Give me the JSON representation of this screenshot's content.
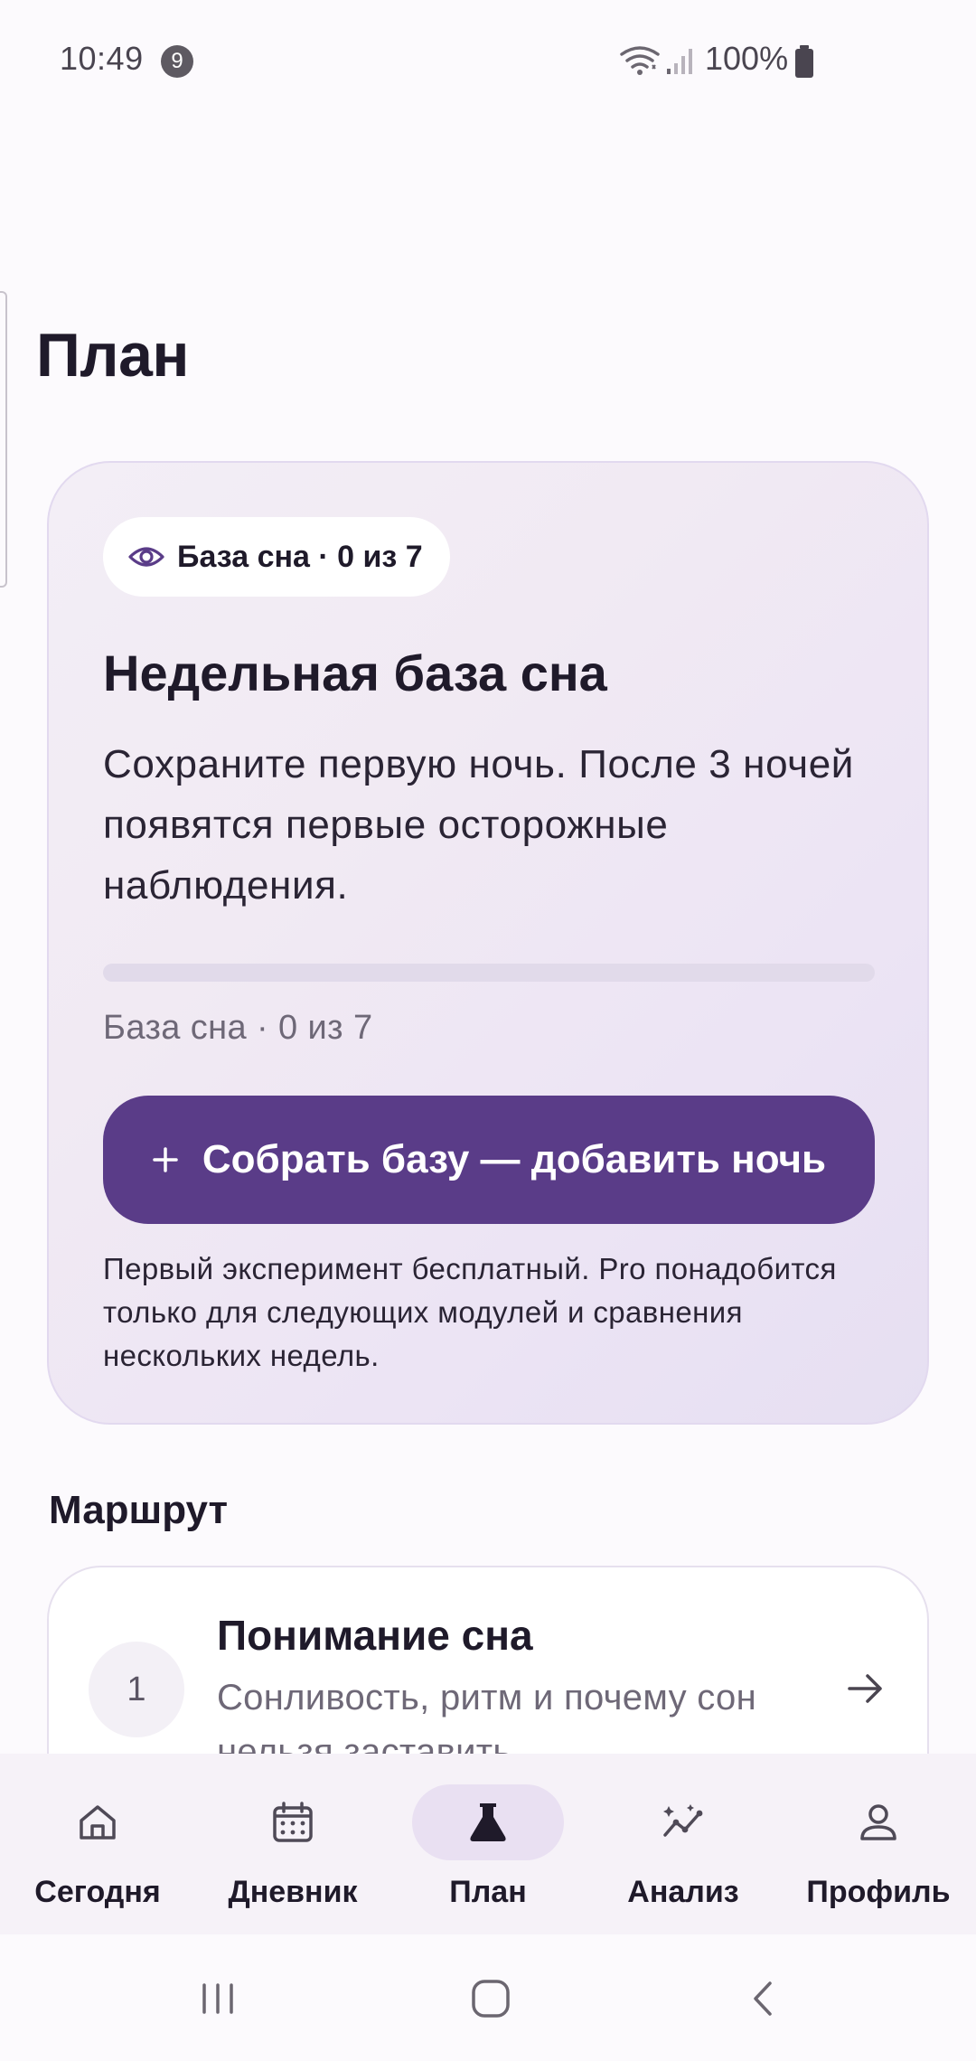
{
  "status_bar": {
    "time": "10:49",
    "notification_count": "9",
    "battery": "100%"
  },
  "header": {
    "title": "План"
  },
  "baseline_card": {
    "chip_label": "База сна · 0 из 7",
    "chip_icon": "eye-icon",
    "title": "Недельная база сна",
    "description": "Сохраните первую ночь. После 3 ночей появятся первые осторожные наблюдения.",
    "progress": {
      "label": "База сна · 0 из 7",
      "current": 0,
      "total": 7
    },
    "button_label": "Собрать базу — добавить ночь",
    "button_icon": "plus-icon",
    "note": "Первый эксперимент бесплатный. Pro понадобится только для следующих модулей и сравнения нескольких недель."
  },
  "route": {
    "section_title": "Маршрут",
    "items": [
      {
        "number": "1",
        "title": "Понимание сна",
        "description": "Сонливость, ритм и почему сон нельзя заставить"
      }
    ]
  },
  "bottom_nav": {
    "active": "plan",
    "items": [
      {
        "id": "today",
        "label": "Сегодня",
        "icon": "home-icon"
      },
      {
        "id": "diary",
        "label": "Дневник",
        "icon": "calendar-icon"
      },
      {
        "id": "plan",
        "label": "План",
        "icon": "flask-icon"
      },
      {
        "id": "analysis",
        "label": "Анализ",
        "icon": "chart-icon"
      },
      {
        "id": "profile",
        "label": "Профиль",
        "icon": "person-icon"
      }
    ]
  },
  "colors": {
    "accent": "#5A3C88",
    "background": "#FCFAFD",
    "text": "#1F1A2A",
    "muted_text": "#6E6877"
  }
}
